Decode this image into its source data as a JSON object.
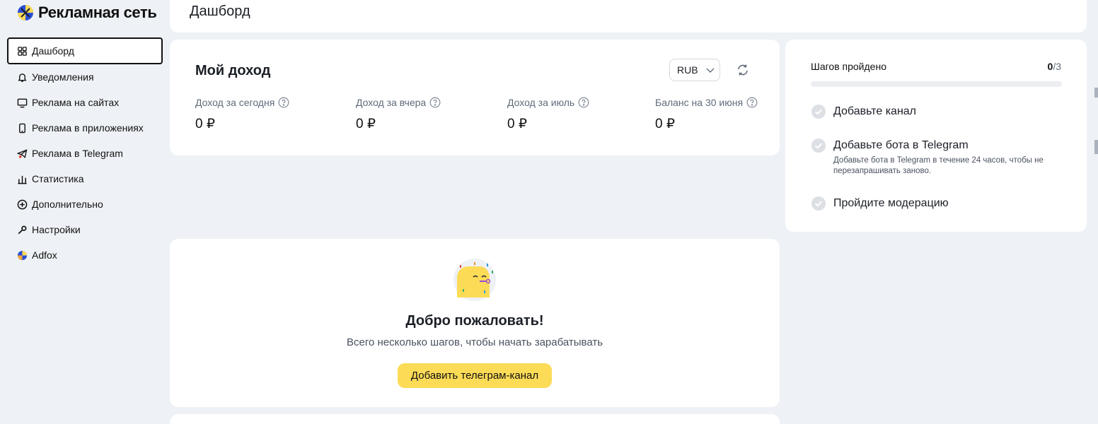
{
  "app": {
    "logo_text": "Рекламная сеть"
  },
  "sidebar": {
    "items": [
      {
        "label": "Дашборд",
        "icon": "grid-icon"
      },
      {
        "label": "Уведомления",
        "icon": "bell-icon"
      },
      {
        "label": "Реклама на сайтах",
        "icon": "monitor-icon"
      },
      {
        "label": "Реклама в приложениях",
        "icon": "phone-icon"
      },
      {
        "label": "Реклама в Telegram",
        "icon": "telegram-icon"
      },
      {
        "label": "Статистика",
        "icon": "bar-chart-icon"
      },
      {
        "label": "Дополнительно",
        "icon": "plus-circle-icon"
      },
      {
        "label": "Настройки",
        "icon": "wrench-icon"
      },
      {
        "label": "Adfox",
        "icon": "adfox-icon"
      }
    ]
  },
  "header": {
    "title": "Дашборд"
  },
  "income": {
    "title": "Мой доход",
    "currency": "RUB",
    "stats": [
      {
        "label": "Доход за сегодня",
        "value": "0 ₽"
      },
      {
        "label": "Доход за вчера",
        "value": "0 ₽"
      },
      {
        "label": "Доход за июль",
        "value": "0 ₽"
      },
      {
        "label": "Баланс на 30 июня",
        "value": "0 ₽"
      }
    ]
  },
  "steps": {
    "heading": "Шагов пройдено",
    "done": "0",
    "total": "/3",
    "progress": 0,
    "items": [
      {
        "title": "Добавьте канал",
        "desc": ""
      },
      {
        "title": "Добавьте бота в Telegram",
        "desc": "Добавьте бота в Telegram в течение 24 часов, чтобы не перезапрашивать заново."
      },
      {
        "title": "Пройдите модерацию",
        "desc": ""
      }
    ]
  },
  "welcome": {
    "title": "Добро пожаловать!",
    "subtitle": "Всего несколько шагов, чтобы начать зарабатывать",
    "button": "Добавить телеграм-канал"
  },
  "colors": {
    "accent": "#fcdb57",
    "background": "#eef1f5",
    "card": "#ffffff"
  }
}
